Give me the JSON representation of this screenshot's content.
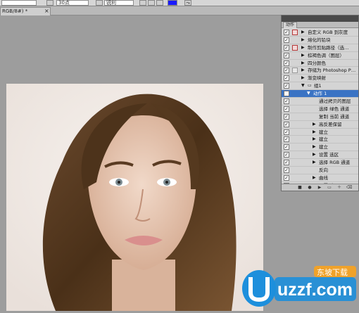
{
  "options_bar": {
    "font_size": "30点",
    "aa_mode": "锐利",
    "color": "#1a1aff"
  },
  "document": {
    "tab_label": "RGB/8#) *"
  },
  "actions_panel": {
    "tab_label": "动作",
    "rows": [
      {
        "label": "自定义 RGB 到灰度",
        "checked": true,
        "dialog": "red",
        "indent": 0,
        "arrow": "right"
      },
      {
        "label": "熔化的铅块",
        "checked": true,
        "dialog": "none",
        "indent": 0,
        "arrow": "right"
      },
      {
        "label": "制作剪贴路径（选…",
        "checked": true,
        "dialog": "red",
        "indent": 0,
        "arrow": "right"
      },
      {
        "label": "棕褐色调（图层）",
        "checked": true,
        "dialog": "none",
        "indent": 0,
        "arrow": "right"
      },
      {
        "label": "四分颜色",
        "checked": true,
        "dialog": "none",
        "indent": 0,
        "arrow": "right"
      },
      {
        "label": "存储为 Photoshop P…",
        "checked": true,
        "dialog": "gray",
        "indent": 0,
        "arrow": "right"
      },
      {
        "label": "渐变映射",
        "checked": true,
        "dialog": "none",
        "indent": 0,
        "arrow": "right"
      },
      {
        "label": "组1",
        "checked": true,
        "dialog": "none",
        "indent": 0,
        "arrow": "down",
        "folder": true
      },
      {
        "label": "动作 1",
        "checked": true,
        "dialog": "none",
        "indent": 1,
        "arrow": "down",
        "selected": true
      },
      {
        "label": "通过拷贝的图层",
        "checked": true,
        "dialog": "none",
        "indent": 2,
        "arrow": "none"
      },
      {
        "label": "选择 绿色 通道",
        "checked": true,
        "dialog": "none",
        "indent": 2,
        "arrow": "none"
      },
      {
        "label": "复制 当前 通道",
        "checked": true,
        "dialog": "none",
        "indent": 2,
        "arrow": "none"
      },
      {
        "label": "高反差保留",
        "checked": true,
        "dialog": "none",
        "indent": 2,
        "arrow": "right"
      },
      {
        "label": "建立",
        "checked": true,
        "dialog": "none",
        "indent": 2,
        "arrow": "right"
      },
      {
        "label": "建立",
        "checked": true,
        "dialog": "none",
        "indent": 2,
        "arrow": "right"
      },
      {
        "label": "建立",
        "checked": true,
        "dialog": "none",
        "indent": 2,
        "arrow": "right"
      },
      {
        "label": "设置 选区",
        "checked": true,
        "dialog": "none",
        "indent": 2,
        "arrow": "right"
      },
      {
        "label": "选择 RGB 通道",
        "checked": true,
        "dialog": "none",
        "indent": 2,
        "arrow": "right"
      },
      {
        "label": "反向",
        "checked": true,
        "dialog": "none",
        "indent": 2,
        "arrow": "none"
      },
      {
        "label": "曲线",
        "checked": true,
        "dialog": "none",
        "indent": 2,
        "arrow": "right"
      },
      {
        "label": "设置 选区",
        "checked": true,
        "dialog": "none",
        "indent": 2,
        "arrow": "right"
      }
    ],
    "footer_buttons": [
      "stop-icon",
      "record-icon",
      "play-icon",
      "new-set-icon",
      "new-action-icon",
      "delete-icon"
    ]
  },
  "watermark": {
    "brand": "uzzf.com",
    "tagline": "东坡下载"
  }
}
